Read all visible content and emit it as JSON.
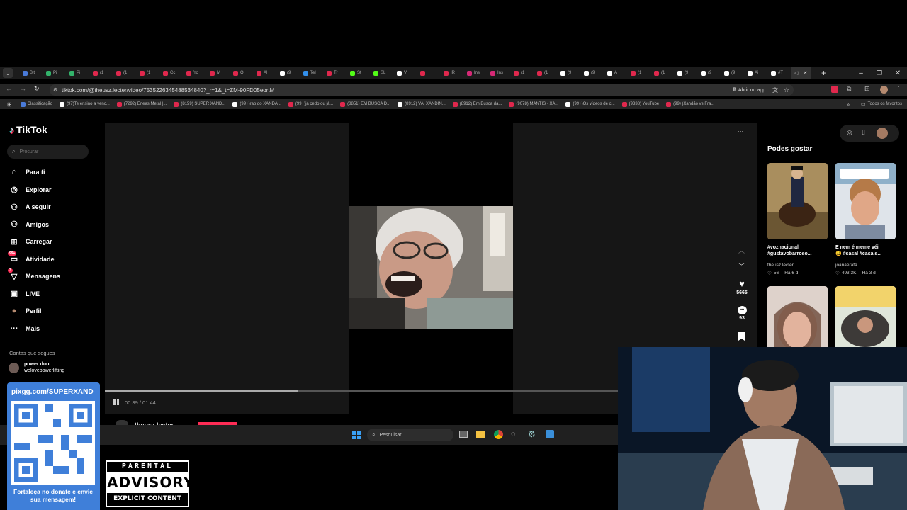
{
  "browser": {
    "tabs": [
      {
        "label": "Bit",
        "color": "#4a7bd9"
      },
      {
        "label": "Pi",
        "color": "#33b36b"
      },
      {
        "label": "Pi",
        "color": "#33b36b"
      },
      {
        "label": "(1",
        "color": "#e0284d"
      },
      {
        "label": "(1",
        "color": "#e0284d"
      },
      {
        "label": "(1",
        "color": "#e0284d"
      },
      {
        "label": "Cc",
        "color": "#e0284d"
      },
      {
        "label": "Yo",
        "color": "#e0284d"
      },
      {
        "label": "M",
        "color": "#e0284d"
      },
      {
        "label": "O",
        "color": "#e0284d"
      },
      {
        "label": "Al",
        "color": "#e0284d"
      },
      {
        "label": "(9",
        "color": "#ffffff"
      },
      {
        "label": "Tel",
        "color": "#3390ec"
      },
      {
        "label": "Tr",
        "color": "#e0284d"
      },
      {
        "label": "St",
        "color": "#53fc18"
      },
      {
        "label": "SL",
        "color": "#53fc18"
      },
      {
        "label": "Vi",
        "color": "#ffffff"
      },
      {
        "label": "",
        "color": "#e0284d"
      },
      {
        "label": "IR",
        "color": "#e0284d"
      },
      {
        "label": "Ins",
        "color": "#d62976"
      },
      {
        "label": "Ins",
        "color": "#d62976"
      },
      {
        "label": "(1",
        "color": "#e0284d"
      },
      {
        "label": "(1",
        "color": "#e0284d"
      },
      {
        "label": "(9",
        "color": "#ffffff"
      },
      {
        "label": "(9",
        "color": "#ffffff"
      },
      {
        "label": "A",
        "color": "#ffffff"
      },
      {
        "label": "(1",
        "color": "#e0284d"
      },
      {
        "label": "(1",
        "color": "#e0284d"
      },
      {
        "label": "(9",
        "color": "#ffffff"
      },
      {
        "label": "(9",
        "color": "#ffffff"
      },
      {
        "label": "(9",
        "color": "#ffffff"
      },
      {
        "label": "Ai",
        "color": "#ffffff"
      },
      {
        "label": "#T",
        "color": "#ffffff"
      }
    ],
    "url": "tiktok.com/@theusz.lecter/video/7535226345488534840?_r=1&_t=ZM-90FD05eortM",
    "open_in_app": "Abrir no app",
    "bookmarks": [
      "Classificação",
      "(97)Te ensino a venc...",
      "(7292) Eneas Metal |...",
      "(8159) SUPER XAND...",
      "(99+)rap do XANDÃ...",
      "(99+)já cedo ou já...",
      "(8851) EM BUSCA D...",
      "(8912) VAI XANDIN...",
      "(8912) Em Busca da...",
      "(9078) MANTIS · XA...",
      "(99+)Os vídeos de c...",
      "(9338) YouTube",
      "(99+)Xandão vs Fra..."
    ],
    "all_bookmarks": "Todos os favoritos"
  },
  "tiktok": {
    "logo": "TikTok",
    "search_placeholder": "Procurar",
    "nav": [
      {
        "label": "Para ti",
        "icon": "home-icon",
        "glyph": "⌂"
      },
      {
        "label": "Explorar",
        "icon": "compass-icon",
        "glyph": "◎"
      },
      {
        "label": "A seguir",
        "icon": "following-icon",
        "glyph": "⚇"
      },
      {
        "label": "Amigos",
        "icon": "friends-icon",
        "glyph": "⚇"
      },
      {
        "label": "Carregar",
        "icon": "upload-icon",
        "glyph": "⊞"
      },
      {
        "label": "Atividade",
        "icon": "inbox-icon",
        "glyph": "▭",
        "badge": "99+"
      },
      {
        "label": "Mensagens",
        "icon": "messages-icon",
        "glyph": "▽",
        "badge": "3"
      },
      {
        "label": "LIVE",
        "icon": "live-icon",
        "glyph": "▣"
      },
      {
        "label": "Perfil",
        "icon": "profile-avatar-icon",
        "glyph": "●"
      },
      {
        "label": "Mais",
        "icon": "more-icon",
        "glyph": "···"
      }
    ],
    "following_header": "Contas que segues",
    "following": [
      {
        "name": "power duo",
        "handle": "welovepowerlifting"
      }
    ],
    "player": {
      "time": "00:39 / 01:44",
      "progress": 0.375,
      "author": "theusz.lecter",
      "likes": "5665",
      "comments": "93"
    },
    "suggestions_title": "Podes gostar",
    "suggestions": [
      {
        "caption1": "#voznacional",
        "caption2": "#gustavobarroso...",
        "author": "theusz.lecter",
        "likes": "56",
        "age": "Há 6 d"
      },
      {
        "caption1": "E nem é meme véi",
        "caption2": "😩 #casal #casais...",
        "author": "joanaerafa",
        "likes": "493.3K",
        "age": "Há 3 d"
      },
      {
        "caption1": "",
        "caption2": "",
        "author": "",
        "likes": "",
        "age": ""
      },
      {
        "caption1": "",
        "caption2": "",
        "author": "",
        "likes": "",
        "age": ""
      }
    ]
  },
  "taskbar": {
    "search_placeholder": "Pesquisar"
  },
  "overlay": {
    "pix_url": "pixgg.com/SUPERXAND",
    "donate_text": "Fortaleça no donate e envie sua mensagem!",
    "advisory_line1": "PARENTAL",
    "advisory_line2": "ADVISORY",
    "advisory_line3": "EXPLICIT CONTENT"
  }
}
